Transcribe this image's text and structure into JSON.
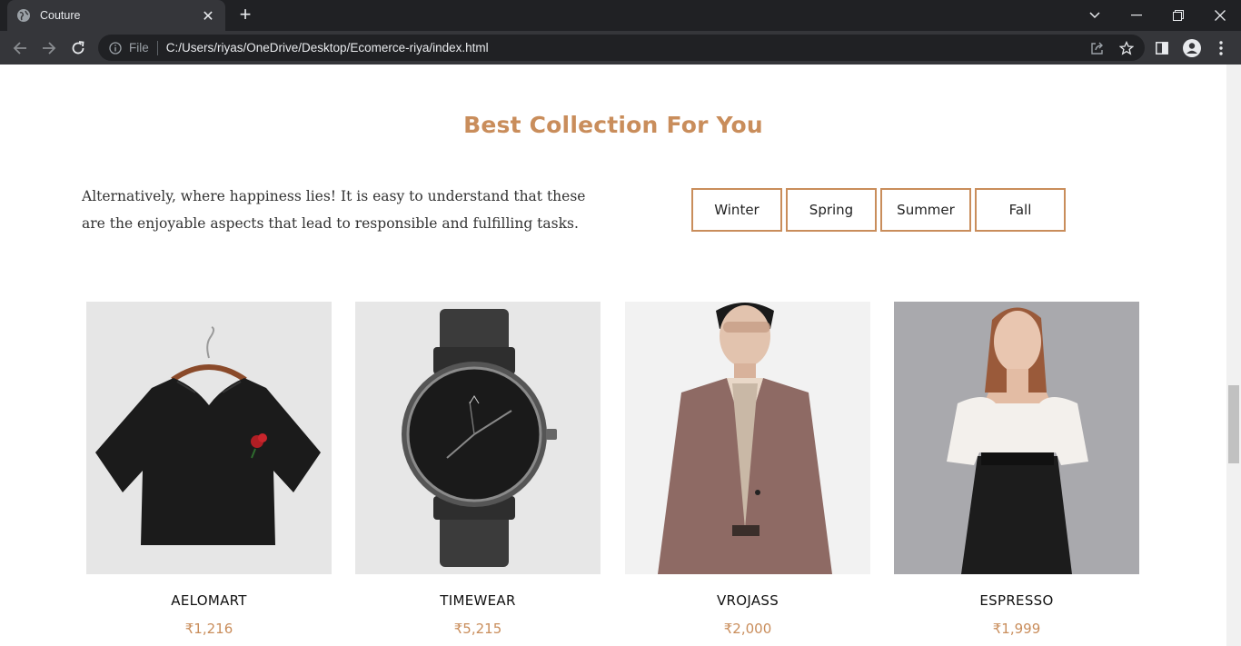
{
  "browser": {
    "tab_title": "Couture",
    "new_tab": "+",
    "omnibox_file": "File",
    "url": "C:/Users/riyas/OneDrive/Desktop/Ecomerce-riya/index.html"
  },
  "section": {
    "title": "Best Collection For You",
    "intro": "Alternatively, where happiness lies! It is easy to understand that these are the enjoyable aspects that lead to responsible and fulfilling tasks."
  },
  "seasons": [
    "Winter",
    "Spring",
    "Summer",
    "Fall"
  ],
  "products": [
    {
      "name": "AELOMART",
      "price": "₹1,216"
    },
    {
      "name": "TIMEWEAR",
      "price": "₹5,215"
    },
    {
      "name": "VROJASS",
      "price": "₹2,000"
    },
    {
      "name": "ESPRESSO",
      "price": "₹1,999"
    }
  ],
  "colors": {
    "accent": "#c98d5b",
    "chrome_dark": "#202124",
    "chrome_mid": "#35363a"
  }
}
